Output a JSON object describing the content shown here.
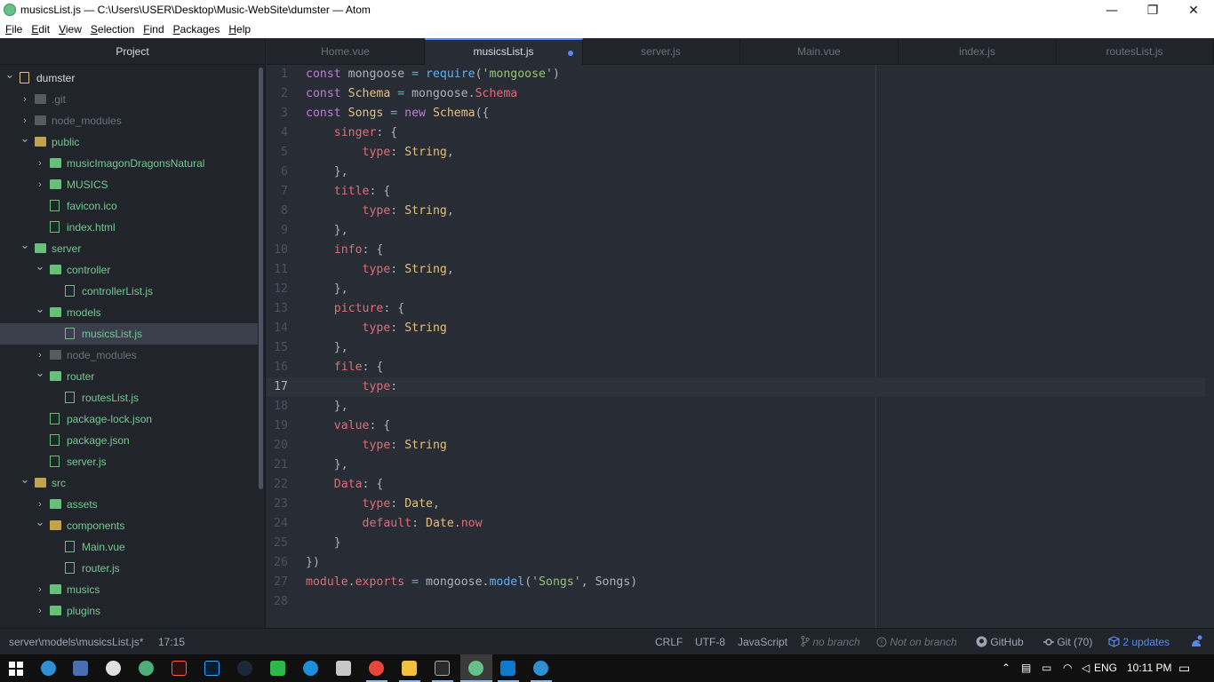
{
  "window": {
    "title": "musicsList.js — C:\\Users\\USER\\Desktop\\Music-WebSite\\dumster — Atom",
    "controls": {
      "minimize": "—",
      "maximize": "❐",
      "close": "✕"
    }
  },
  "menubar": [
    "File",
    "Edit",
    "View",
    "Selection",
    "Find",
    "Packages",
    "Help"
  ],
  "sidebar": {
    "title": "Project",
    "tree": [
      {
        "label": "dumster",
        "depth": 0,
        "kind": "project",
        "expanded": true,
        "color": "yellow"
      },
      {
        "label": ".git",
        "depth": 1,
        "kind": "folder",
        "expanded": false,
        "color": "ignored"
      },
      {
        "label": "node_modules",
        "depth": 1,
        "kind": "folder",
        "expanded": false,
        "color": "ignored"
      },
      {
        "label": "public",
        "depth": 1,
        "kind": "folder",
        "expanded": true,
        "color": "yellow"
      },
      {
        "label": "musicImagonDragonsNatural",
        "depth": 2,
        "kind": "folder",
        "expanded": false,
        "color": "green"
      },
      {
        "label": "MUSICS",
        "depth": 2,
        "kind": "folder",
        "expanded": false,
        "color": "green"
      },
      {
        "label": "favicon.ico",
        "depth": 2,
        "kind": "image",
        "color": "green"
      },
      {
        "label": "index.html",
        "depth": 2,
        "kind": "file",
        "color": "green"
      },
      {
        "label": "server",
        "depth": 1,
        "kind": "folder",
        "expanded": true,
        "color": "green"
      },
      {
        "label": "controller",
        "depth": 2,
        "kind": "folder",
        "expanded": true,
        "color": "green"
      },
      {
        "label": "controllerList.js",
        "depth": 3,
        "kind": "file",
        "color": "green"
      },
      {
        "label": "models",
        "depth": 2,
        "kind": "folder",
        "expanded": true,
        "color": "green"
      },
      {
        "label": "musicsList.js",
        "depth": 3,
        "kind": "file",
        "color": "green",
        "selected": true
      },
      {
        "label": "node_modules",
        "depth": 2,
        "kind": "folder",
        "expanded": false,
        "color": "ignored"
      },
      {
        "label": "router",
        "depth": 2,
        "kind": "folder",
        "expanded": true,
        "color": "green"
      },
      {
        "label": "routesList.js",
        "depth": 3,
        "kind": "file",
        "color": "green"
      },
      {
        "label": "package-lock.json",
        "depth": 2,
        "kind": "file",
        "color": "green"
      },
      {
        "label": "package.json",
        "depth": 2,
        "kind": "file",
        "color": "green"
      },
      {
        "label": "server.js",
        "depth": 2,
        "kind": "file",
        "color": "green"
      },
      {
        "label": "src",
        "depth": 1,
        "kind": "folder",
        "expanded": true,
        "color": "yellow"
      },
      {
        "label": "assets",
        "depth": 2,
        "kind": "folder",
        "expanded": false,
        "color": "green"
      },
      {
        "label": "components",
        "depth": 2,
        "kind": "folder",
        "expanded": true,
        "color": "yellow"
      },
      {
        "label": "Main.vue",
        "depth": 3,
        "kind": "file",
        "color": "green"
      },
      {
        "label": "router.js",
        "depth": 3,
        "kind": "file",
        "color": "green"
      },
      {
        "label": "musics",
        "depth": 2,
        "kind": "folder",
        "expanded": false,
        "color": "green"
      },
      {
        "label": "plugins",
        "depth": 2,
        "kind": "folder",
        "expanded": false,
        "color": "green"
      }
    ]
  },
  "tabs": [
    {
      "label": "Home.vue",
      "active": false,
      "modified": false
    },
    {
      "label": "musicsList.js",
      "active": true,
      "modified": true
    },
    {
      "label": "server.js",
      "active": false,
      "modified": false
    },
    {
      "label": "Main.vue",
      "active": false,
      "modified": false
    },
    {
      "label": "index.js",
      "active": false,
      "modified": false
    },
    {
      "label": "routesList.js",
      "active": false,
      "modified": false
    }
  ],
  "editor": {
    "cursor_line": 17,
    "lines": [
      [
        [
          "kw",
          "const "
        ],
        [
          "pl",
          "mongoose "
        ],
        [
          "op",
          "= "
        ],
        [
          "fn",
          "require"
        ],
        [
          "pl",
          "("
        ],
        [
          "str",
          "'mongoose'"
        ],
        [
          "pl",
          ")"
        ]
      ],
      [
        [
          "kw",
          "const "
        ],
        [
          "cls",
          "Schema "
        ],
        [
          "op",
          "= "
        ],
        [
          "pl",
          "mongoose."
        ],
        [
          "prop",
          "Schema"
        ]
      ],
      [
        [
          "kw",
          "const "
        ],
        [
          "cls",
          "Songs "
        ],
        [
          "op",
          "= "
        ],
        [
          "kw",
          "new "
        ],
        [
          "cls",
          "Schema"
        ],
        [
          "pl",
          "({"
        ]
      ],
      [
        [
          "pl",
          "    "
        ],
        [
          "prop",
          "singer"
        ],
        [
          "pl",
          ": {"
        ]
      ],
      [
        [
          "pl",
          "        "
        ],
        [
          "prop",
          "type"
        ],
        [
          "pl",
          ": "
        ],
        [
          "cls",
          "String"
        ],
        [
          "pl",
          ","
        ]
      ],
      [
        [
          "pl",
          "    },"
        ]
      ],
      [
        [
          "pl",
          "    "
        ],
        [
          "prop",
          "title"
        ],
        [
          "pl",
          ": {"
        ]
      ],
      [
        [
          "pl",
          "        "
        ],
        [
          "prop",
          "type"
        ],
        [
          "pl",
          ": "
        ],
        [
          "cls",
          "String"
        ],
        [
          "pl",
          ","
        ]
      ],
      [
        [
          "pl",
          "    },"
        ]
      ],
      [
        [
          "pl",
          "    "
        ],
        [
          "prop",
          "info"
        ],
        [
          "pl",
          ": {"
        ]
      ],
      [
        [
          "pl",
          "        "
        ],
        [
          "prop",
          "type"
        ],
        [
          "pl",
          ": "
        ],
        [
          "cls",
          "String"
        ],
        [
          "pl",
          ","
        ]
      ],
      [
        [
          "pl",
          "    },"
        ]
      ],
      [
        [
          "pl",
          "    "
        ],
        [
          "prop",
          "picture"
        ],
        [
          "pl",
          ": {"
        ]
      ],
      [
        [
          "pl",
          "        "
        ],
        [
          "prop",
          "type"
        ],
        [
          "pl",
          ": "
        ],
        [
          "cls",
          "String"
        ]
      ],
      [
        [
          "pl",
          "    },"
        ]
      ],
      [
        [
          "pl",
          "    "
        ],
        [
          "prop",
          "file"
        ],
        [
          "pl",
          ": {"
        ]
      ],
      [
        [
          "pl",
          "        "
        ],
        [
          "prop",
          "type"
        ],
        [
          "pl",
          ":"
        ]
      ],
      [
        [
          "pl",
          "    },"
        ]
      ],
      [
        [
          "pl",
          "    "
        ],
        [
          "prop",
          "value"
        ],
        [
          "pl",
          ": {"
        ]
      ],
      [
        [
          "pl",
          "        "
        ],
        [
          "prop",
          "type"
        ],
        [
          "pl",
          ": "
        ],
        [
          "cls",
          "String"
        ]
      ],
      [
        [
          "pl",
          "    },"
        ]
      ],
      [
        [
          "pl",
          "    "
        ],
        [
          "prop",
          "Data"
        ],
        [
          "pl",
          ": {"
        ]
      ],
      [
        [
          "pl",
          "        "
        ],
        [
          "prop",
          "type"
        ],
        [
          "pl",
          ": "
        ],
        [
          "cls",
          "Date"
        ],
        [
          "pl",
          ","
        ]
      ],
      [
        [
          "pl",
          "        "
        ],
        [
          "prop",
          "default"
        ],
        [
          "pl",
          ": "
        ],
        [
          "cls",
          "Date"
        ],
        [
          "pl",
          "."
        ],
        [
          "prop",
          "now"
        ]
      ],
      [
        [
          "pl",
          "    }"
        ]
      ],
      [
        [
          "pl",
          "})"
        ]
      ],
      [
        [
          "prop",
          "module"
        ],
        [
          "pl",
          "."
        ],
        [
          "prop",
          "exports "
        ],
        [
          "op",
          "= "
        ],
        [
          "pl",
          "mongoose."
        ],
        [
          "fn",
          "model"
        ],
        [
          "pl",
          "("
        ],
        [
          "str",
          "'Songs'"
        ],
        [
          "pl",
          ", Songs)"
        ]
      ],
      [
        [
          "pl",
          ""
        ]
      ]
    ]
  },
  "statusbar": {
    "file_path": "server\\models\\musicsList.js*",
    "cursor_pos": "17:15",
    "line_ending": "CRLF",
    "encoding": "UTF-8",
    "grammar": "JavaScript",
    "branch": "no branch",
    "remote": "Not on branch",
    "github": "GitHub",
    "git": "Git (70)",
    "updates": "2 updates"
  },
  "taskbar": {
    "language": "ENG",
    "time": "10:11 PM"
  },
  "colors": {
    "accent": "#568af2",
    "vcs_added": "#73c990",
    "vcs_ignored": "#6b717d",
    "folder_open": "#e5c07b"
  }
}
